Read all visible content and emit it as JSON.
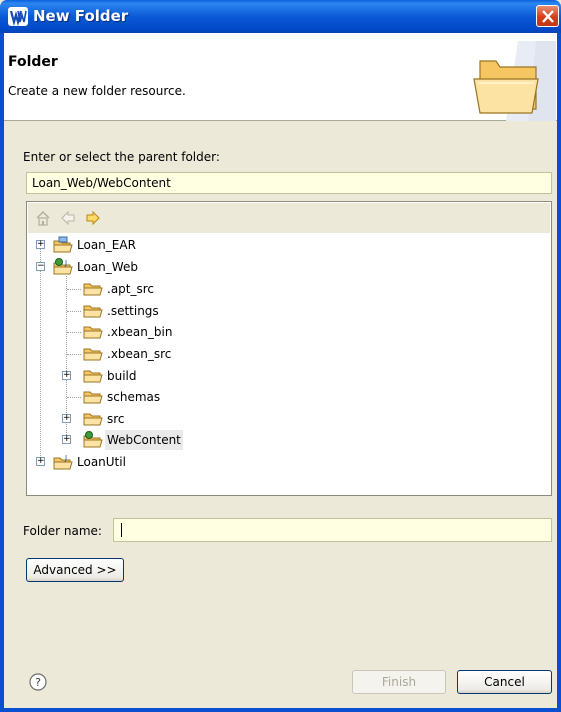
{
  "window": {
    "title": "New Folder"
  },
  "banner": {
    "title": "Folder",
    "description": "Create a new folder resource."
  },
  "parent": {
    "label": "Enter or select the parent folder:",
    "value": "Loan_Web/WebContent"
  },
  "tree": {
    "items": [
      {
        "label": "Loan_EAR"
      },
      {
        "label": "Loan_Web"
      },
      {
        "label": ".apt_src"
      },
      {
        "label": ".settings"
      },
      {
        "label": ".xbean_bin"
      },
      {
        "label": ".xbean_src"
      },
      {
        "label": "build"
      },
      {
        "label": "schemas"
      },
      {
        "label": "src"
      },
      {
        "label": "WebContent"
      },
      {
        "label": "LoanUtil"
      }
    ]
  },
  "folder_name": {
    "label": "Folder name:",
    "value": ""
  },
  "buttons": {
    "advanced": "Advanced >>",
    "finish": "Finish",
    "cancel": "Cancel"
  },
  "icons": {
    "window_icon": "websphere-icon",
    "banner_art": "open-folder-icon",
    "home": "home-icon",
    "back": "back-arrow-icon",
    "forward": "forward-arrow-icon",
    "help": "help-icon"
  },
  "colors": {
    "titlebar": "#0c5ad8",
    "field_background": "#ffffe1",
    "dialog_background": "#ece9d8"
  }
}
